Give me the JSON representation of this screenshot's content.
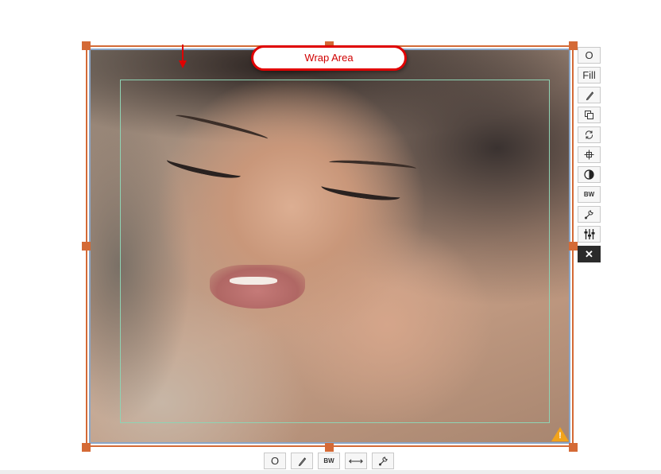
{
  "editor": {
    "wrap_label": "Wrap Area"
  },
  "side_toolbar": {
    "items": [
      {
        "id": "original",
        "label": "O",
        "icon": ""
      },
      {
        "id": "fill",
        "label": "Fill",
        "icon": ""
      },
      {
        "id": "edit",
        "label": "",
        "icon": "pencil-icon"
      },
      {
        "id": "duplicate",
        "label": "",
        "icon": "duplicate-icon"
      },
      {
        "id": "rotate",
        "label": "",
        "icon": "rotate-icon"
      },
      {
        "id": "center",
        "label": "",
        "icon": "crosshair-icon"
      },
      {
        "id": "color",
        "label": "",
        "icon": "color-wheel-icon"
      },
      {
        "id": "bw",
        "label": "BW",
        "icon": ""
      },
      {
        "id": "tools",
        "label": "",
        "icon": "wrench-icon"
      },
      {
        "id": "adjust",
        "label": "",
        "icon": "sliders-icon"
      },
      {
        "id": "delete",
        "label": "✕",
        "icon": "close-icon"
      }
    ]
  },
  "bottom_toolbar": {
    "items": [
      {
        "id": "original",
        "label": "O",
        "icon": ""
      },
      {
        "id": "edit",
        "label": "",
        "icon": "pencil-icon"
      },
      {
        "id": "bw",
        "label": "BW",
        "icon": ""
      },
      {
        "id": "flip",
        "label": "⟷",
        "icon": "flip-horizontal-icon"
      },
      {
        "id": "tools",
        "label": "",
        "icon": "wrench-icon"
      }
    ]
  },
  "colors": {
    "selection_border": "#d46a36",
    "inner_border": "#8aa6c8",
    "guide": "#8fd3b4",
    "annotation": "#e00000",
    "warning": "#f2a31b"
  }
}
